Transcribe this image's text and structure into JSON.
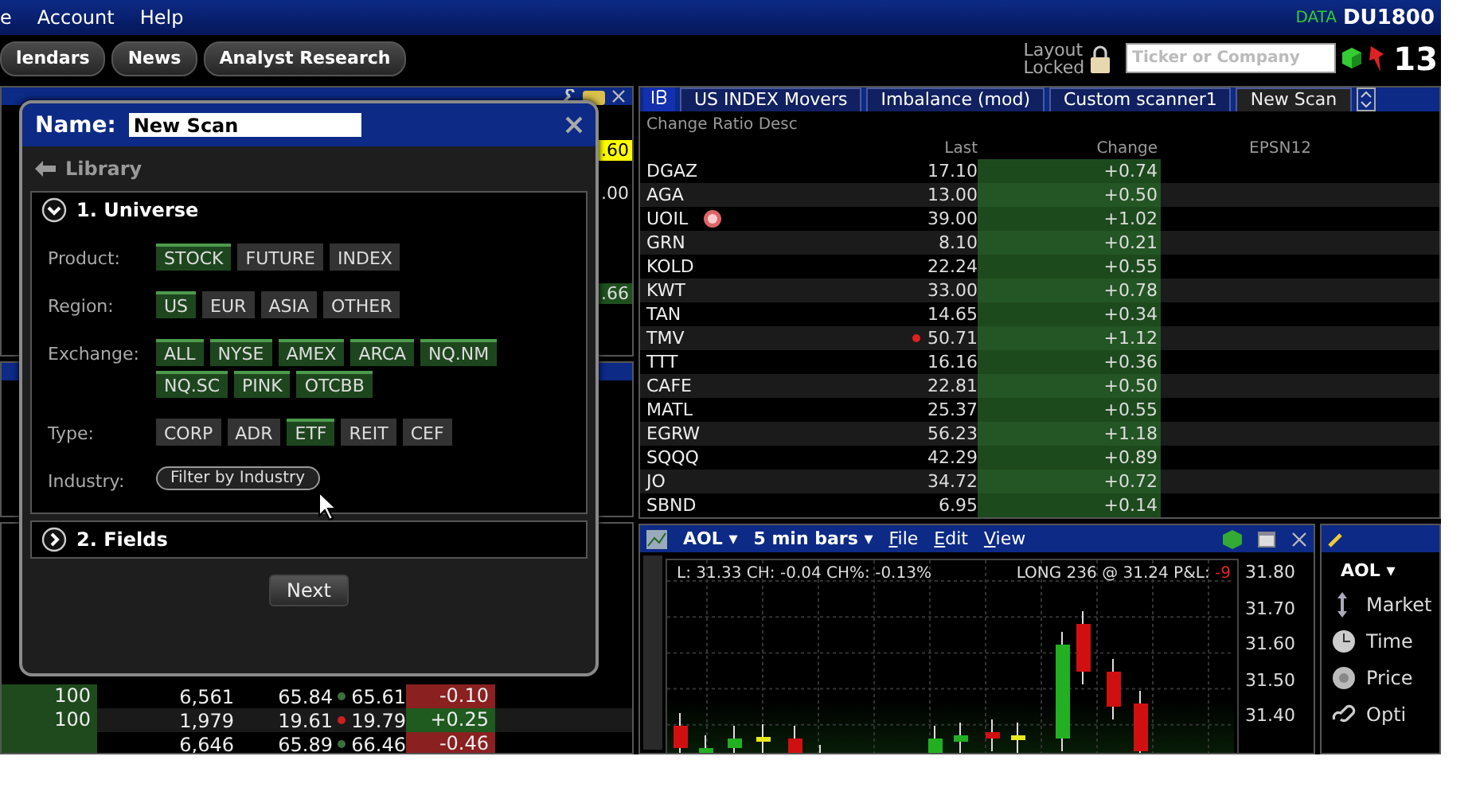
{
  "menu_bar": {
    "items": [
      "e",
      "Account",
      "Help"
    ],
    "data_label": "DATA",
    "account": "DU1800"
  },
  "toolbar": {
    "buttons": [
      "lendars",
      "News",
      "Analyst Research"
    ],
    "layout_status": [
      "Layout",
      "Locked"
    ],
    "ticker_field": {
      "placeholder": "Ticker or Company"
    },
    "counter": "13"
  },
  "left_panels": {
    "values": [
      {
        "text": ".60",
        "kind": "flash"
      },
      {
        "text": ".00",
        "kind": "plain"
      },
      {
        "text": ".66",
        "kind": "up"
      }
    ],
    "rows": [
      {
        "qty": "100",
        "col_2": "6,561",
        "col_3": "65.84",
        "color": "#3d6e3d",
        "last": "65.61",
        "change": "-0.10",
        "kind": "down"
      },
      {
        "qty": "100",
        "col_2": "1,979",
        "col_3": "19.61",
        "color": "#cc2020",
        "last": "19.79",
        "change": "+0.25",
        "kind": "up"
      },
      {
        "col_2": "6,646",
        "col_3": "65.89",
        "color": "#3d6e3d",
        "last": "66.46",
        "change": "-0.46",
        "kind": "down"
      }
    ]
  },
  "scanner": {
    "tabs": [
      {
        "label": "US INDEX Movers",
        "selected": false
      },
      {
        "label": "Imbalance (mod)",
        "selected": false
      },
      {
        "label": "Custom scanner1",
        "selected": false
      },
      {
        "label": "New Scan",
        "selected": true
      }
    ],
    "sort_label": "Change Ratio Desc",
    "columns": [
      "Last",
      "Change",
      "EPSN12"
    ],
    "rows": [
      {
        "symbol": "DGAZ",
        "last": "17.10",
        "change": "+0.74",
        "flag": false,
        "tick": false
      },
      {
        "symbol": "AGA",
        "last": "13.00",
        "change": "+0.50",
        "flag": false,
        "tick": false
      },
      {
        "symbol": "UOIL",
        "last": "39.00",
        "change": "+1.02",
        "flag": true,
        "tick": false
      },
      {
        "symbol": "GRN",
        "last": "8.10",
        "change": "+0.21",
        "flag": false,
        "tick": false
      },
      {
        "symbol": "KOLD",
        "last": "22.24",
        "change": "+0.55",
        "flag": false,
        "tick": false
      },
      {
        "symbol": "KWT",
        "last": "33.00",
        "change": "+0.78",
        "flag": false,
        "tick": false
      },
      {
        "symbol": "TAN",
        "last": "14.65",
        "change": "+0.34",
        "flag": false,
        "tick": false
      },
      {
        "symbol": "TMV",
        "last": "50.71",
        "change": "+1.12",
        "flag": false,
        "tick": true
      },
      {
        "symbol": "TTT",
        "last": "16.16",
        "change": "+0.36",
        "flag": false,
        "tick": false
      },
      {
        "symbol": "CAFE",
        "last": "22.81",
        "change": "+0.50",
        "flag": false,
        "tick": false
      },
      {
        "symbol": "MATL",
        "last": "25.37",
        "change": "+0.55",
        "flag": false,
        "tick": false
      },
      {
        "symbol": "EGRW",
        "last": "56.23",
        "change": "+1.18",
        "flag": false,
        "tick": false
      },
      {
        "symbol": "SQQQ",
        "last": "42.29",
        "change": "+0.89",
        "flag": false,
        "tick": false
      },
      {
        "symbol": "JO",
        "last": "34.72",
        "change": "+0.72",
        "flag": false,
        "tick": false
      },
      {
        "symbol": "SBND",
        "last": "6.95",
        "change": "+0.14",
        "flag": false,
        "tick": false
      }
    ]
  },
  "chart": {
    "symbol": "AOL ▾",
    "period": "5 min bars ▾",
    "menus": [
      "File",
      "Edit",
      "View"
    ],
    "info": "L: 31.33 CH: -0.04  CH%: -0.13%",
    "position": "LONG 236 @ 31.24 P&L:",
    "pnl": "-9",
    "y_labels": [
      "31.80",
      "31.70",
      "31.60",
      "31.50",
      "31.40"
    ]
  },
  "side_panel": {
    "symbol": "AOL ▾",
    "items": [
      {
        "label": "Market",
        "kind": "arrows"
      },
      {
        "label": "Time",
        "kind": "clock"
      },
      {
        "label": "Price",
        "kind": "gauge"
      },
      {
        "label": "Opti",
        "kind": "chain"
      }
    ]
  },
  "dialog": {
    "name_label": "Name:",
    "name_value": "New Scan",
    "back": "Library",
    "sections": [
      {
        "title": "1. Universe",
        "expanded": true,
        "rows": [
          {
            "label": "Product:",
            "kind": "chips",
            "options": [
              {
                "label": "STOCK",
                "selected": true
              },
              {
                "label": "FUTURE",
                "selected": false
              },
              {
                "label": "INDEX",
                "selected": false
              }
            ]
          },
          {
            "label": "Region:",
            "kind": "chips",
            "options": [
              {
                "label": "US",
                "selected": true
              },
              {
                "label": "EUR",
                "selected": false
              },
              {
                "label": "ASIA",
                "selected": false
              },
              {
                "label": "OTHER",
                "selected": false
              }
            ]
          },
          {
            "label": "Exchange:",
            "kind": "chips",
            "options": [
              {
                "label": "ALL",
                "selected": true
              },
              {
                "label": "NYSE",
                "selected": true
              },
              {
                "label": "AMEX",
                "selected": true
              },
              {
                "label": "ARCA",
                "selected": true
              },
              {
                "label": "NQ.NM",
                "selected": true
              },
              {
                "label": "NQ.SC",
                "selected": true
              },
              {
                "label": "PINK",
                "selected": true
              },
              {
                "label": "OTCBB",
                "selected": true
              }
            ]
          },
          {
            "label": "Type:",
            "kind": "chips",
            "options": [
              {
                "label": "CORP",
                "selected": false
              },
              {
                "label": "ADR",
                "selected": false
              },
              {
                "label": "ETF",
                "selected": true
              },
              {
                "label": "REIT",
                "selected": false
              },
              {
                "label": "CEF",
                "selected": false
              }
            ]
          },
          {
            "label": "Industry:",
            "kind": "button",
            "button": "Filter by Industry"
          }
        ]
      },
      {
        "title": "2. Fields",
        "expanded": false
      }
    ],
    "next": "Next"
  }
}
